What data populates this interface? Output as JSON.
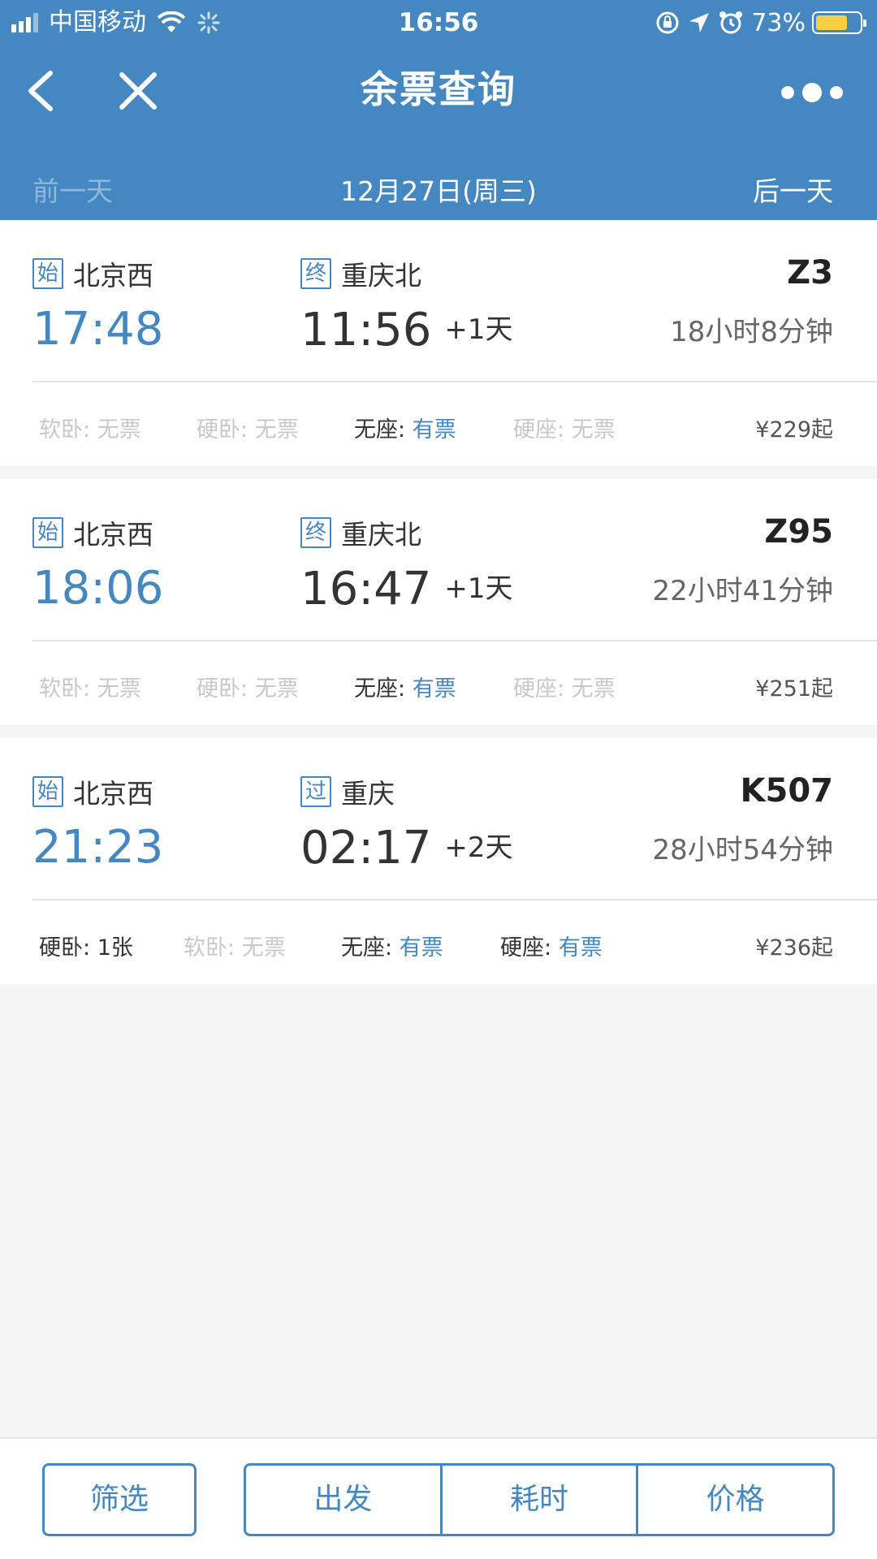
{
  "status_bar": {
    "carrier": "中国移动",
    "time": "16:56",
    "battery_percent": "73%",
    "battery_level": 0.73,
    "icons": [
      "signal-icon",
      "wifi-icon",
      "loading-icon",
      "rotation-lock-icon",
      "location-icon",
      "alarm-icon",
      "battery-icon"
    ]
  },
  "nav": {
    "title": "余票查询",
    "back_icon": "chevron-left-icon",
    "close_icon": "close-icon",
    "more_icon": "more-dots-icon"
  },
  "date_bar": {
    "prev": "前一天",
    "current": "12月27日(周三)",
    "next": "后一天"
  },
  "trains": [
    {
      "from_badge": "始",
      "from": "北京西",
      "to_badge": "终",
      "to": "重庆北",
      "train_no": "Z3",
      "depart": "17:48",
      "arrive": "11:56",
      "plus_day": "+1天",
      "duration": "18小时8分钟",
      "seats": [
        {
          "name": "软卧:",
          "status": "无票",
          "available": false
        },
        {
          "name": "硬卧:",
          "status": "无票",
          "available": false
        },
        {
          "name": "无座:",
          "status": "有票",
          "available": true
        },
        {
          "name": "硬座:",
          "status": "无票",
          "available": false
        }
      ],
      "price": "¥229起"
    },
    {
      "from_badge": "始",
      "from": "北京西",
      "to_badge": "终",
      "to": "重庆北",
      "train_no": "Z95",
      "depart": "18:06",
      "arrive": "16:47",
      "plus_day": "+1天",
      "duration": "22小时41分钟",
      "seats": [
        {
          "name": "软卧:",
          "status": "无票",
          "available": false
        },
        {
          "name": "硬卧:",
          "status": "无票",
          "available": false
        },
        {
          "name": "无座:",
          "status": "有票",
          "available": true
        },
        {
          "name": "硬座:",
          "status": "无票",
          "available": false
        }
      ],
      "price": "¥251起"
    },
    {
      "from_badge": "始",
      "from": "北京西",
      "to_badge": "过",
      "to": "重庆",
      "train_no": "K507",
      "depart": "21:23",
      "arrive": "02:17",
      "plus_day": "+2天",
      "duration": "28小时54分钟",
      "seats": [
        {
          "name": "硬卧:",
          "status": "1张",
          "available": "count"
        },
        {
          "name": "软卧:",
          "status": "无票",
          "available": false
        },
        {
          "name": "无座:",
          "status": "有票",
          "available": true
        },
        {
          "name": "硬座:",
          "status": "有票",
          "available": true
        }
      ],
      "price": "¥236起"
    }
  ],
  "toolbar": {
    "filter": "筛选",
    "sort_depart": "出发",
    "sort_duration": "耗时",
    "sort_price": "价格"
  },
  "colors": {
    "brand_blue": "#4587c1",
    "battery_yellow": "#f7d142",
    "unavailable_gray": "#c8c8c8"
  }
}
